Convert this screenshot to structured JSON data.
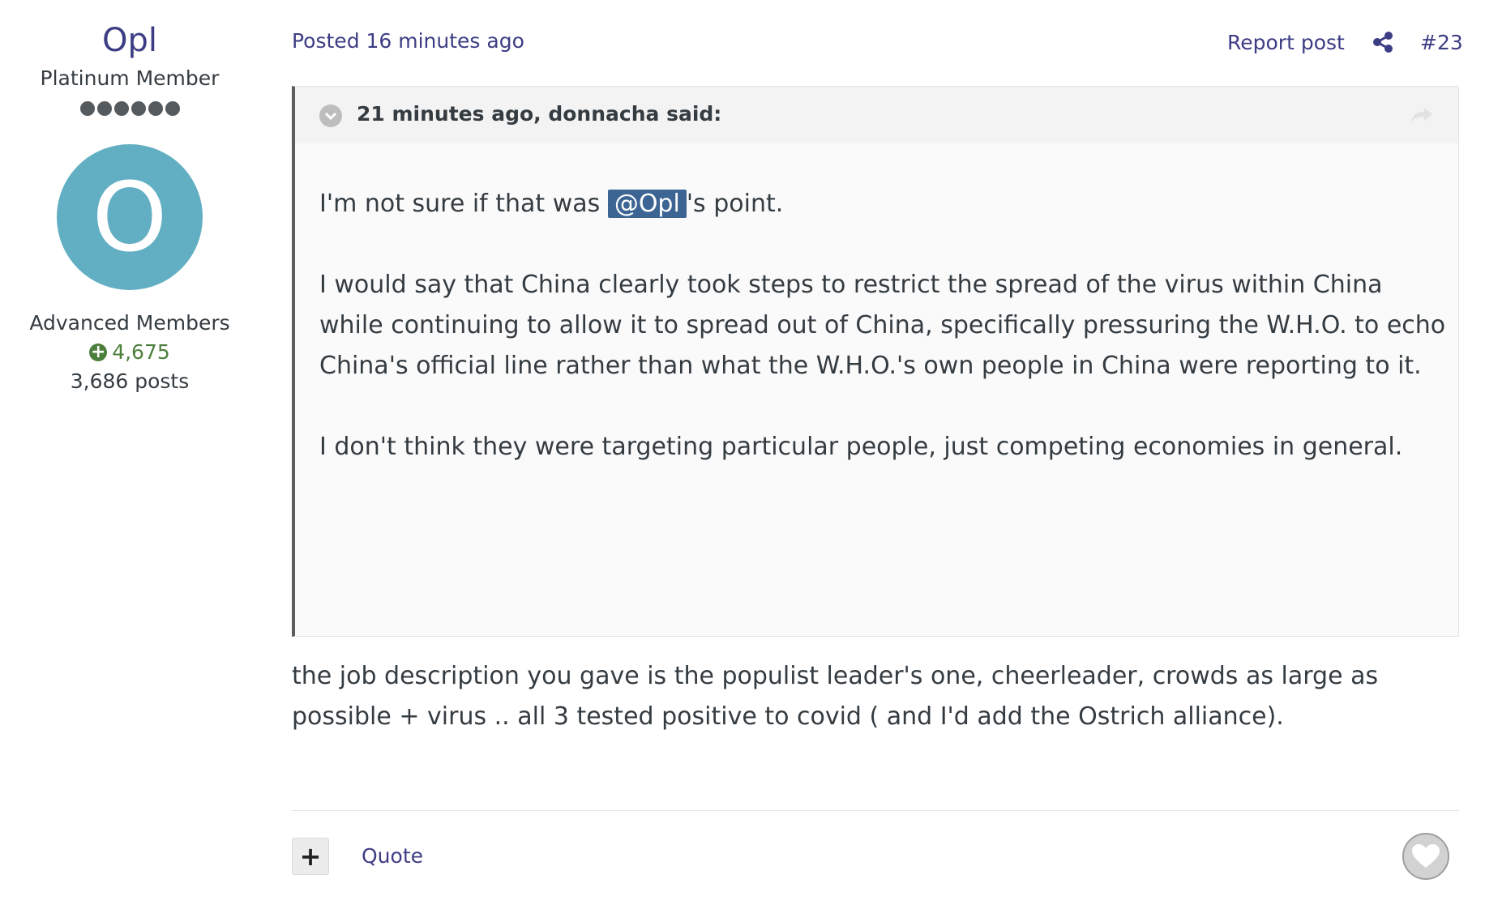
{
  "author": {
    "name": "Opl",
    "rank_title": "Platinum Member",
    "rank_pips": 6,
    "avatar_letter": "O",
    "group": "Advanced Members",
    "reputation": "4,675",
    "post_count": "3,686 posts"
  },
  "post": {
    "posted": "Posted 16 minutes ago",
    "report_label": "Report post",
    "share_icon": "share-icon",
    "number": "#23",
    "quote": {
      "citation": "21 minutes ago, donnacha said:",
      "p1_before": "I'm not sure if that was ",
      "mention": "@Opl",
      "p1_after": "'s point.",
      "p2": "I would say that China clearly took steps to restrict the spread of the virus within China while continuing to allow it to spread out of China, specifically pressuring the W.H.O. to echo China's official line rather than what the W.H.O.'s own people in China were reporting to it.",
      "p3": "I don't think they were targeting particular people, just competing economies in general."
    },
    "content": "the job description you gave is the populist leader's one, cheerleader, crowds as large as possible + virus .. all 3 tested positive to covid ( and I'd add the Ostrich alliance).",
    "multiquote_label": "+",
    "quote_label": "Quote"
  },
  "colors": {
    "link": "#3d3d85",
    "avatar_bg": "#62afc3",
    "reputation": "#4d7f3c",
    "mention_bg": "#3d6594",
    "quote_border": "#5d5d5d"
  }
}
